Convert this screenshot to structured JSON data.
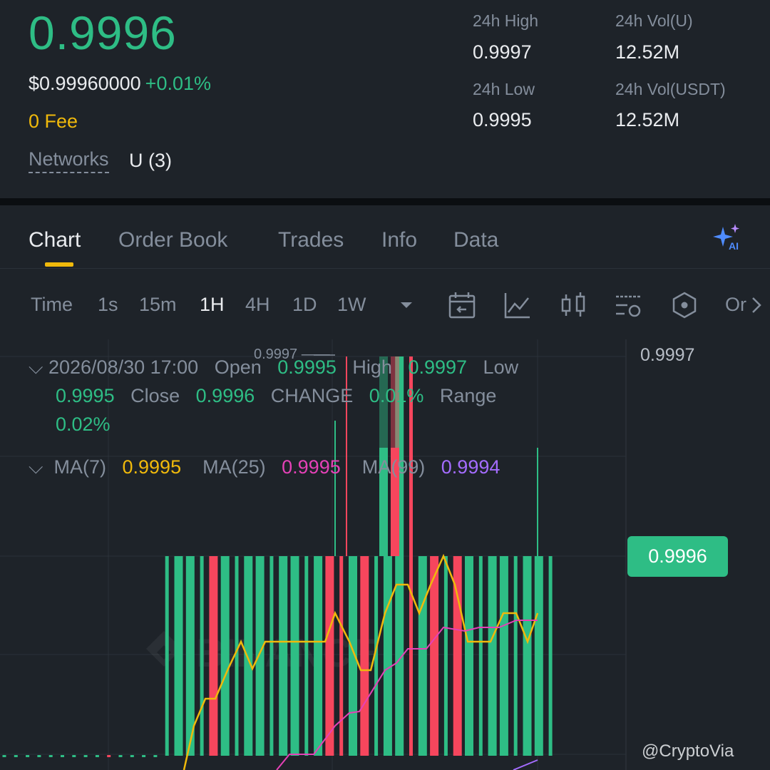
{
  "header": {
    "price": "0.9996",
    "usd_price": "$0.99960000",
    "change_pct": "+0.01%",
    "fee": "0 Fee",
    "networks_label": "Networks",
    "networks_value": "U (3)",
    "stats": {
      "high_label": "24h High",
      "high_value": "0.9997",
      "low_label": "24h Low",
      "low_value": "0.9995",
      "vol_u_label": "24h Vol(U)",
      "vol_u_value": "12.52M",
      "vol_usdt_label": "24h Vol(USDT)",
      "vol_usdt_value": "12.52M"
    }
  },
  "tabs": [
    "Chart",
    "Order Book",
    "Trades",
    "Info",
    "Data"
  ],
  "active_tab": "Chart",
  "toolbar": {
    "time_label": "Time",
    "intervals": [
      "1s",
      "15m",
      "1H",
      "4H",
      "1D",
      "1W"
    ],
    "active_interval": "1H",
    "truncated_label": "Or"
  },
  "candle_info": {
    "datetime": "2026/08/30 17:00",
    "open_label": "Open",
    "open": "0.9995",
    "high_label": "High",
    "high": "0.9997",
    "low_label": "Low",
    "low": "0.9995",
    "close_label": "Close",
    "close": "0.9996",
    "change_label": "CHANGE",
    "change": "0.01%",
    "range_label": "Range",
    "range": "0.02%"
  },
  "ma": {
    "ma7_label": "MA(7)",
    "ma7": "0.9995",
    "ma25_label": "MA(25)",
    "ma25": "0.9995",
    "ma99_label": "MA(99)",
    "ma99": "0.9994"
  },
  "chart_labels": {
    "axis_top": "0.9997",
    "high_marker": "0.9997",
    "current_price_tag": "0.9996"
  },
  "watermark": "@CryptoVia",
  "colors": {
    "up": "#2ebd85",
    "down": "#f6465d",
    "accent": "#f0b90b",
    "ma7": "#f0b90b",
    "ma25": "#e541b7",
    "ma99": "#a46cff"
  },
  "chart_data": {
    "type": "candlestick",
    "note": "1H candles; mostly flat between 0.9995 and 0.9996",
    "candles": [
      {
        "o": 0.9995,
        "c": 0.9995,
        "dir": "up"
      },
      {
        "o": 0.9995,
        "c": 0.9995,
        "dir": "up"
      },
      {
        "o": 0.9995,
        "c": 0.9995,
        "dir": "up"
      },
      {
        "o": 0.9995,
        "c": 0.9995,
        "dir": "up"
      },
      {
        "o": 0.9995,
        "c": 0.9995,
        "dir": "up"
      },
      {
        "o": 0.9995,
        "c": 0.9995,
        "dir": "up"
      },
      {
        "o": 0.9995,
        "c": 0.9995,
        "dir": "up"
      },
      {
        "o": 0.9995,
        "c": 0.9995,
        "dir": "up"
      },
      {
        "o": 0.9995,
        "c": 0.9995,
        "dir": "up"
      },
      {
        "o": 0.9995,
        "c": 0.9995,
        "dir": "down"
      },
      {
        "o": 0.9995,
        "c": 0.9995,
        "dir": "up"
      },
      {
        "o": 0.9995,
        "c": 0.9995,
        "dir": "up"
      },
      {
        "o": 0.9995,
        "c": 0.9995,
        "dir": "up"
      },
      {
        "o": 0.9995,
        "c": 0.9995,
        "dir": "up"
      },
      {
        "o": 0.9995,
        "c": 0.9996,
        "dir": "up"
      },
      {
        "o": 0.9995,
        "c": 0.9996,
        "dir": "up"
      },
      {
        "o": 0.9995,
        "c": 0.9996,
        "dir": "up"
      },
      {
        "o": 0.9995,
        "c": 0.9996,
        "dir": "up"
      },
      {
        "o": 0.9996,
        "c": 0.9995,
        "dir": "down"
      },
      {
        "o": 0.9995,
        "c": 0.9996,
        "dir": "up"
      },
      {
        "o": 0.9995,
        "c": 0.9996,
        "dir": "up"
      },
      {
        "o": 0.9995,
        "c": 0.9996,
        "dir": "up"
      },
      {
        "o": 0.9995,
        "c": 0.9996,
        "dir": "up"
      },
      {
        "o": 0.9995,
        "c": 0.9996,
        "dir": "up"
      },
      {
        "o": 0.9995,
        "c": 0.9996,
        "dir": "up"
      },
      {
        "o": 0.9995,
        "c": 0.9996,
        "dir": "up"
      },
      {
        "o": 0.9995,
        "c": 0.9996,
        "dir": "up"
      },
      {
        "o": 0.9995,
        "c": 0.9996,
        "dir": "up"
      },
      {
        "o": 0.9996,
        "c": 0.9995,
        "dir": "down"
      },
      {
        "o": 0.9996,
        "c": 0.9995,
        "dir": "down"
      },
      {
        "o": 0.9995,
        "c": 0.9996,
        "dir": "up"
      },
      {
        "o": 0.9996,
        "c": 0.9995,
        "dir": "down"
      },
      {
        "o": 0.9995,
        "c": 0.9996,
        "dir": "up"
      },
      {
        "o": 0.9995,
        "c": 0.9996,
        "dir": "up"
      },
      {
        "o": 0.9995,
        "c": 0.9997,
        "dir": "up"
      },
      {
        "o": 0.9997,
        "c": 0.9995,
        "dir": "down"
      },
      {
        "o": 0.9995,
        "c": 0.9996,
        "dir": "up"
      },
      {
        "o": 0.9996,
        "c": 0.9995,
        "dir": "down"
      },
      {
        "o": 0.9995,
        "c": 0.9996,
        "dir": "up"
      },
      {
        "o": 0.9996,
        "c": 0.9995,
        "dir": "down"
      },
      {
        "o": 0.9995,
        "c": 0.9996,
        "dir": "up"
      },
      {
        "o": 0.9995,
        "c": 0.9996,
        "dir": "up"
      },
      {
        "o": 0.9995,
        "c": 0.9996,
        "dir": "up"
      },
      {
        "o": 0.9995,
        "c": 0.9996,
        "dir": "up"
      },
      {
        "o": 0.9995,
        "c": 0.9996,
        "dir": "up"
      },
      {
        "o": 0.9995,
        "c": 0.9996,
        "dir": "up"
      },
      {
        "o": 0.9995,
        "c": 0.9996,
        "dir": "up"
      },
      {
        "o": 0.9995,
        "c": 0.9996,
        "dir": "up"
      }
    ]
  }
}
